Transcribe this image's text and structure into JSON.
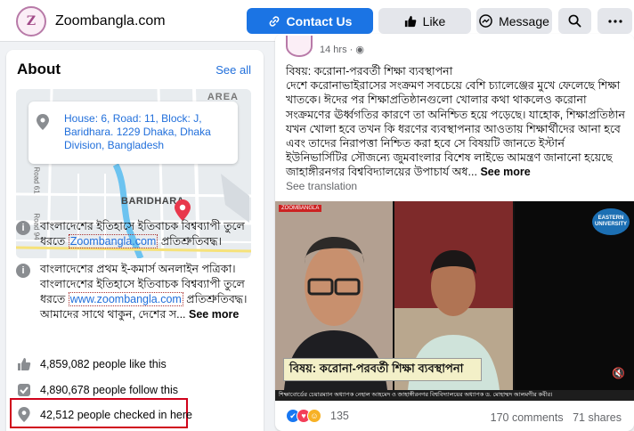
{
  "header": {
    "site_name": "Zoombangla.com",
    "contact_label": "Contact Us",
    "like_label": "Like",
    "message_label": "Message",
    "search_icon": "search-icon",
    "more_icon": "more-options-icon",
    "primary_color": "#1b74e4"
  },
  "about": {
    "title": "About",
    "see_all": "See all",
    "map": {
      "address": "House: 6, Road: 11, Block: J, Baridhara. 1229 Dhaka, Dhaka Division, Bangladesh",
      "area_label": "AREA",
      "place_label": "BARIDHARA",
      "road_label_1": "Road 61",
      "road_label_2": "Road 94"
    },
    "info_1": {
      "prefix": "বাংলাদেশের ইতিহাসে ইতিবাচক বিশ্বব্যাপী তুলে ধরতে ",
      "link": "Zoombangla.com",
      "suffix": " প্রতিশ্রুতিবদ্ধ।"
    },
    "info_2": {
      "line1": "বাংলাদেশের প্রথম ই-কমার্স অনলাইন পত্রিকা।",
      "line2": "বাংলাদেশের ইতিহাসে ইতিবাচক বিশ্বব্যাপী তুলে ধরতে ",
      "link": "www.zoombangla.com",
      "suffix": " প্রতিশ্রুতিবদ্ধ। আমাদের সাথে থাকুন, দেশের স...",
      "see_more": "See more"
    },
    "stats": {
      "likes": "4,859,082 people like this",
      "follows": "4,890,678 people follow this",
      "checkins": "42,512 people checked in here"
    }
  },
  "post": {
    "time": "14 hrs · ",
    "text": "বিষয়: করোনা-পরবর্তী শিক্ষা ব্যবস্থাপনা\nদেশে করোনাভাইরাসের সংক্রমণ সবচেয়ে বেশি চ্যালেঞ্জের মুখে ফেলেছে শিক্ষা খাতকে। ঈদের পর শিক্ষাপ্রতিষ্ঠানগুলো খোলার কথা থাকলেও করোনা সংক্রমণের ঊর্ধ্বগতির কারণে তা অনিশ্চিত হয়ে পড়েছে। যাহোক, শিক্ষাপ্রতিষ্ঠান যখন খোলা হবে তখন কি ধরণের ব্যবস্থাপনার আওতায় শিক্ষার্থীদের আনা হবে এবং তাদের নিরাপত্তা নিশ্চিত করা হবে সে বিষয়টি জানতে ইস্টার্ন ইউনিভার্সিটির সৌজন্যে জুমবাংলার বিশেষ লাইভে আমন্ত্রণ জানানো হয়েছে জাহাঙ্গীরনগর বিশ্ববিদ্যালয়ের উপাচার্য অধ... ",
    "see_more": "See more",
    "see_translation": "See translation",
    "video": {
      "overlay_title": "বিষয়: করোনা-পরবর্তী শিক্ষা ব্যবস্থাপনা",
      "ticker": "শিক্ষাবোর্ডের চেয়ারম্যান অধ্যাপক নেহাল আহমেদ ও জাহাঙ্গীরনগর বিশ্ববিদ্যালয়ের অধ্যাপক ড. মোহাম্মদ আলমগীর কবীর।",
      "pane_tag": "ZOOMBANGLA",
      "university_logo": "EASTERN UNIVERSITY"
    },
    "reactions_count": "135",
    "comments": "170 comments",
    "shares": "71 shares"
  }
}
